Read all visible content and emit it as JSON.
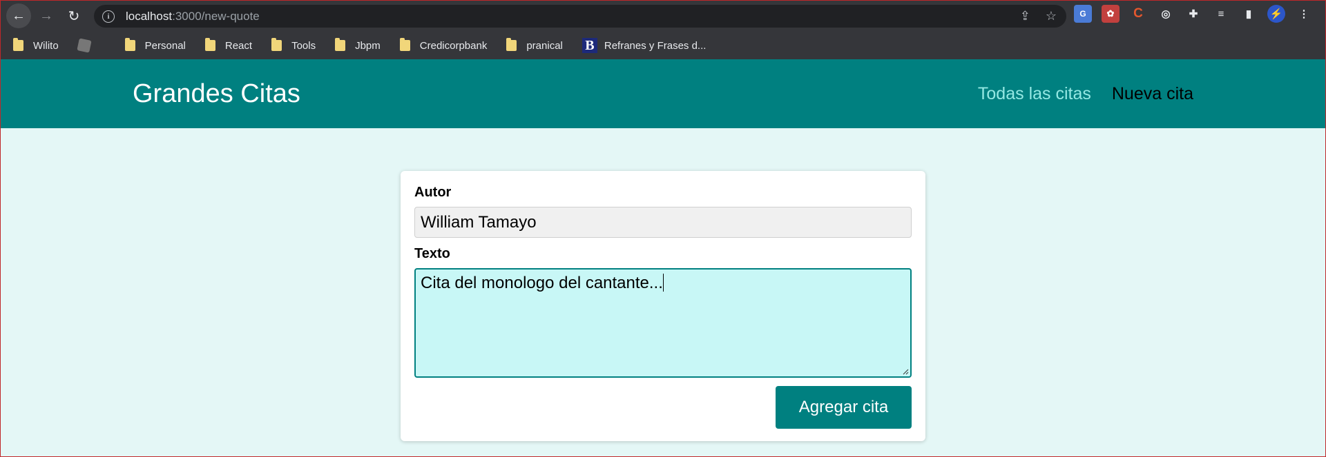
{
  "browser": {
    "url_host": "localhost",
    "url_path": ":3000/new-quote",
    "bookmarks": [
      {
        "label": "Wilito",
        "icon": "folder-icon"
      },
      {
        "label": "",
        "icon": "roblox-icon"
      },
      {
        "label": "Personal",
        "icon": "folder-icon"
      },
      {
        "label": "React",
        "icon": "folder-icon"
      },
      {
        "label": "Tools",
        "icon": "folder-icon"
      },
      {
        "label": "Jbpm",
        "icon": "folder-icon"
      },
      {
        "label": "Credicorpbank",
        "icon": "folder-icon"
      },
      {
        "label": "pranical",
        "icon": "folder-icon"
      },
      {
        "label": "Refranes y Frases d...",
        "icon": "site-b-icon"
      }
    ]
  },
  "header": {
    "title": "Grandes Citas",
    "nav": {
      "all_quotes": "Todas las citas",
      "new_quote": "Nueva cita"
    }
  },
  "form": {
    "author_label": "Autor",
    "author_value": "William Tamayo",
    "text_label": "Texto",
    "text_value": "Cita del monologo del cantante...",
    "submit_label": "Agregar cita"
  },
  "colors": {
    "primary": "#008080",
    "nav_active": "#95e8e3",
    "page_bg": "#e4f7f6",
    "textarea_bg": "#c8f7f6"
  }
}
